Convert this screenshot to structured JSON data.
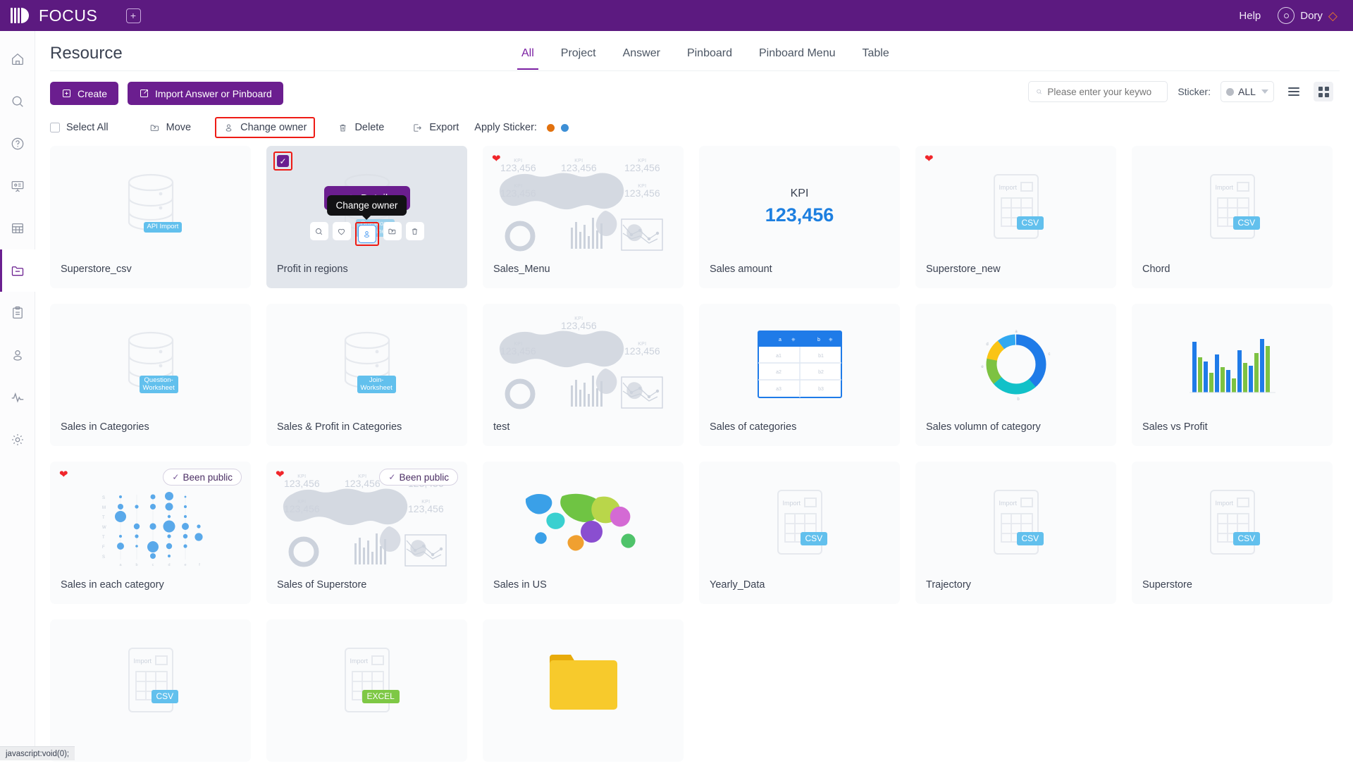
{
  "topbar": {
    "brand": "FOCUS",
    "add_icon": "plus-square-icon",
    "help_label": "Help",
    "user_name": "Dory",
    "gem_icon": "gem-icon"
  },
  "sidebar": {
    "items": [
      {
        "name": "home-icon",
        "label": "Home",
        "active": false
      },
      {
        "name": "search-icon",
        "label": "Search",
        "active": false
      },
      {
        "name": "help-circle-icon",
        "label": "Help",
        "active": false
      },
      {
        "name": "presentation-icon",
        "label": "Presentation",
        "active": false
      },
      {
        "name": "table-grid-icon",
        "label": "Table",
        "active": false
      },
      {
        "name": "folder-icon",
        "label": "Resource",
        "active": true
      },
      {
        "name": "clipboard-icon",
        "label": "Clipboard",
        "active": false
      },
      {
        "name": "user-icon",
        "label": "User",
        "active": false
      },
      {
        "name": "activity-icon",
        "label": "Monitor",
        "active": false
      },
      {
        "name": "gear-icon",
        "label": "Settings",
        "active": false
      }
    ]
  },
  "page": {
    "title": "Resource",
    "tabs": [
      {
        "label": "All",
        "active": true
      },
      {
        "label": "Project",
        "active": false
      },
      {
        "label": "Answer",
        "active": false
      },
      {
        "label": "Pinboard",
        "active": false
      },
      {
        "label": "Pinboard Menu",
        "active": false
      },
      {
        "label": "Table",
        "active": false
      }
    ]
  },
  "toolbar": {
    "create_label": "Create",
    "import_label": "Import Answer or Pinboard",
    "search_placeholder": "Please enter your keywo",
    "sticker_label": "Sticker:",
    "sticker_value": "ALL",
    "sticker_value_color": "#b8bcc4",
    "list_view_icon": "list-view-icon",
    "grid_view_icon": "grid-view-icon",
    "active_view": "grid"
  },
  "selection_bar": {
    "select_all_label": "Select All",
    "move_label": "Move",
    "change_owner_label": "Change owner",
    "change_owner_highlighted": true,
    "delete_label": "Delete",
    "export_label": "Export",
    "apply_sticker_label": "Apply Sticker:",
    "sticker_colors": [
      "#e2710e",
      "#3d8fd6"
    ]
  },
  "hover_card": {
    "detail_label": "Detail",
    "tooltip_label": "Change owner",
    "action_icons": [
      {
        "name": "preview-search-icon",
        "focused": false
      },
      {
        "name": "favorite-heart-icon",
        "focused": false
      },
      {
        "name": "change-owner-person-icon",
        "focused": true
      },
      {
        "name": "move-folder-icon",
        "focused": false
      },
      {
        "name": "delete-trash-icon",
        "focused": false
      }
    ]
  },
  "cards": [
    {
      "name": "Superstore_csv",
      "art": "database",
      "tag": "API Import",
      "tag_color": "#62c0ed",
      "favorite": false,
      "public": false,
      "selected": false,
      "hovered": false
    },
    {
      "name": "Profit in regions",
      "art": "database",
      "tag": "Question-\nWorksheet",
      "tag_color": "#62c0ed",
      "favorite": false,
      "public": false,
      "selected": true,
      "hovered": true
    },
    {
      "name": "Sales_Menu",
      "art": "dashboard",
      "tag": "",
      "tag_color": "",
      "favorite": true,
      "public": false,
      "selected": false,
      "hovered": false
    },
    {
      "name": "Sales amount",
      "art": "kpi",
      "tag": "",
      "tag_color": "",
      "favorite": false,
      "public": false,
      "selected": false,
      "hovered": false
    },
    {
      "name": "Superstore_new",
      "art": "csv",
      "tag": "CSV",
      "tag_color": "#62c0ed",
      "favorite": true,
      "public": false,
      "selected": false,
      "hovered": false
    },
    {
      "name": "Chord",
      "art": "csv",
      "tag": "CSV",
      "tag_color": "#62c0ed",
      "favorite": false,
      "public": false,
      "selected": false,
      "hovered": false
    },
    {
      "name": "Sales in Categories",
      "art": "database",
      "tag": "Question-\nWorksheet",
      "tag_color": "#62c0ed",
      "favorite": false,
      "public": false,
      "selected": false,
      "hovered": false
    },
    {
      "name": "Sales & Profit in Categories",
      "art": "database",
      "tag": "Join-\nWorksheet",
      "tag_color": "#62c0ed",
      "favorite": false,
      "public": false,
      "selected": false,
      "hovered": false
    },
    {
      "name": "test",
      "art": "dashboard",
      "tag": "",
      "tag_color": "",
      "favorite": false,
      "public": false,
      "selected": false,
      "hovered": false
    },
    {
      "name": "Sales of categories",
      "art": "table",
      "tag": "",
      "tag_color": "",
      "favorite": false,
      "public": false,
      "selected": false,
      "hovered": false
    },
    {
      "name": "Sales volumn of category",
      "art": "donut",
      "tag": "",
      "tag_color": "",
      "favorite": false,
      "public": false,
      "selected": false,
      "hovered": false
    },
    {
      "name": "Sales vs Profit",
      "art": "bars",
      "tag": "",
      "tag_color": "",
      "favorite": false,
      "public": false,
      "selected": false,
      "hovered": false
    },
    {
      "name": "Sales in each category",
      "art": "bubble",
      "tag": "",
      "tag_color": "",
      "favorite": true,
      "public": true,
      "selected": false,
      "hovered": false
    },
    {
      "name": "Sales of Superstore",
      "art": "dashboard",
      "tag": "",
      "tag_color": "",
      "favorite": true,
      "public": true,
      "selected": false,
      "hovered": false
    },
    {
      "name": "Sales in US",
      "art": "colormap",
      "tag": "",
      "tag_color": "",
      "favorite": false,
      "public": false,
      "selected": false,
      "hovered": false
    },
    {
      "name": "Yearly_Data",
      "art": "csv",
      "tag": "CSV",
      "tag_color": "#62c0ed",
      "favorite": false,
      "public": false,
      "selected": false,
      "hovered": false
    },
    {
      "name": "Trajectory",
      "art": "csv",
      "tag": "CSV",
      "tag_color": "#62c0ed",
      "favorite": false,
      "public": false,
      "selected": false,
      "hovered": false
    },
    {
      "name": "Superstore",
      "art": "csv",
      "tag": "CSV",
      "tag_color": "#62c0ed",
      "favorite": false,
      "public": false,
      "selected": false,
      "hovered": false
    },
    {
      "name": "",
      "art": "csv",
      "tag": "CSV",
      "tag_color": "#62c0ed",
      "favorite": false,
      "public": false,
      "selected": false,
      "hovered": false
    },
    {
      "name": "",
      "art": "excel",
      "tag": "EXCEL",
      "tag_color": "#7ec845",
      "favorite": false,
      "public": false,
      "selected": false,
      "hovered": false
    },
    {
      "name": "",
      "art": "folder",
      "tag": "",
      "tag_color": "",
      "favorite": false,
      "public": false,
      "selected": false,
      "hovered": false
    }
  ],
  "card_badges": {
    "public_label": "Been public",
    "import_label": "Import"
  },
  "thumbnail_text": {
    "kpi_label": "KPI",
    "kpi_value": "123,456",
    "mini_kpi_label": "KPI",
    "mini_kpi_value": "123,456"
  },
  "statusbar": {
    "text": "javascript:void(0);"
  }
}
